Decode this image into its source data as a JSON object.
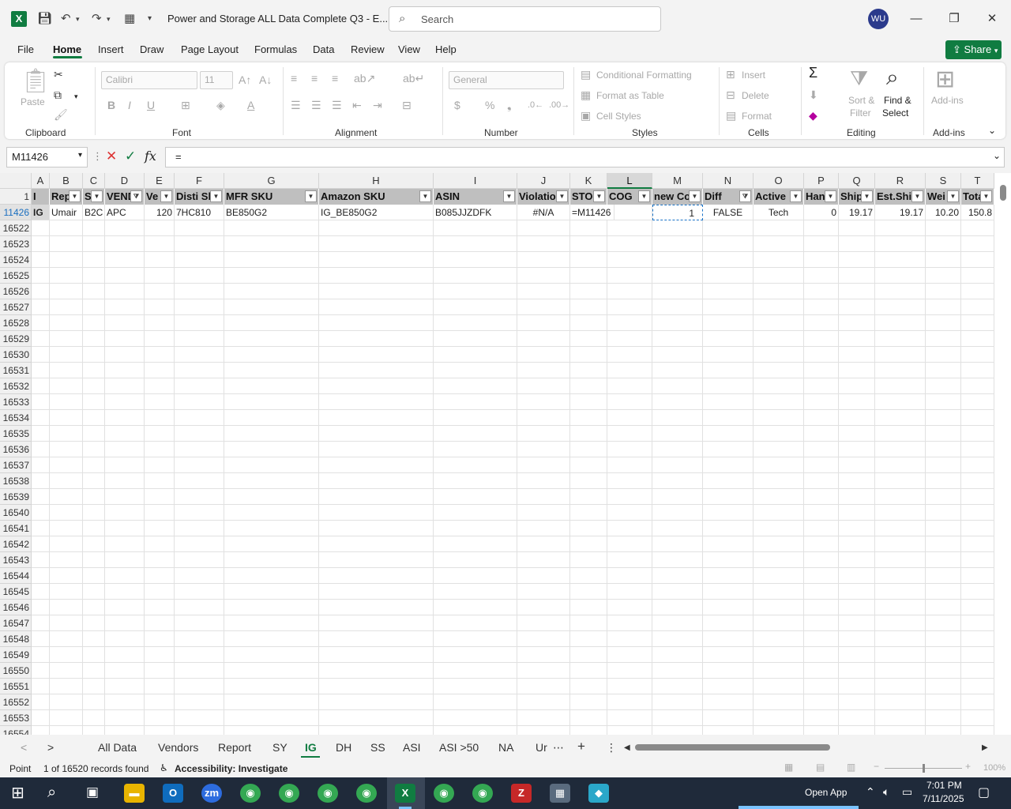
{
  "title_bar": {
    "doc_title": "Power and Storage ALL Data Complete Q3 - E...",
    "search_placeholder": "Search",
    "user_initials": "WU"
  },
  "menu": {
    "tabs": [
      "File",
      "Home",
      "Insert",
      "Draw",
      "Page Layout",
      "Formulas",
      "Data",
      "Review",
      "View",
      "Help"
    ],
    "active": "Home",
    "share": "Share"
  },
  "ribbon": {
    "clipboard": {
      "label": "Clipboard",
      "paste": "Paste"
    },
    "font": {
      "label": "Font",
      "name": "Calibri",
      "size": "11"
    },
    "alignment": {
      "label": "Alignment"
    },
    "number": {
      "label": "Number",
      "format": "General"
    },
    "styles": {
      "label": "Styles",
      "conditional": "Conditional Formatting",
      "format_table": "Format as Table",
      "cell_styles": "Cell Styles"
    },
    "cells": {
      "label": "Cells",
      "insert": "Insert",
      "delete": "Delete",
      "format": "Format"
    },
    "editing": {
      "label": "Editing",
      "sort": "Sort &",
      "filter": "Filter",
      "find": "Find &",
      "select": "Select"
    },
    "addins": {
      "label": "Add-ins",
      "btn": "Add-ins"
    }
  },
  "formula_bar": {
    "name_box": "M11426",
    "formula": "="
  },
  "columns": [
    "A",
    "B",
    "C",
    "D",
    "E",
    "F",
    "G",
    "H",
    "I",
    "J",
    "K",
    "L",
    "M",
    "N",
    "O",
    "P",
    "Q",
    "R",
    "S",
    "T"
  ],
  "header_row": {
    "row_num": "1",
    "cells": [
      "I",
      "Rep",
      "S",
      "VEND",
      "Ve",
      "Disti Sk",
      "MFR SKU",
      "Amazon SKU",
      "ASIN",
      "Violatio",
      "STOC",
      "COG",
      "new Co",
      "Diff",
      "Active",
      "Han",
      "Ship",
      "Est.Shi",
      "Wei",
      "Total"
    ]
  },
  "data_row": {
    "row_num": "11426",
    "cells": [
      "IG",
      "Umair",
      "B2C",
      "APC",
      "120",
      "7HC810",
      "BE850G2",
      "IG_BE850G2",
      "B085JJZDFK",
      "#N/A",
      "=M11426",
      "",
      "1",
      "FALSE",
      "Tech",
      "0",
      "19.17",
      "19.17",
      "10.20",
      "150.8"
    ]
  },
  "empty_rows": [
    "16522",
    "16523",
    "16524",
    "16525",
    "16526",
    "16527",
    "16528",
    "16529",
    "16530",
    "16531",
    "16532",
    "16533",
    "16534",
    "16535",
    "16536",
    "16537",
    "16538",
    "16539",
    "16540",
    "16541",
    "16542",
    "16543",
    "16544",
    "16545",
    "16546",
    "16547",
    "16548",
    "16549",
    "16550",
    "16551",
    "16552",
    "16553",
    "16554"
  ],
  "sheet_tabs": [
    "All Data",
    "Vendors",
    "Report",
    "SY",
    "IG",
    "DH",
    "SS",
    "ASI",
    "ASI >50",
    "NA",
    "Ur"
  ],
  "active_sheet": "IG",
  "status": {
    "mode": "Point",
    "records": "1 of 16520 records found",
    "accessibility": "Accessibility: Investigate",
    "zoom": "100%"
  },
  "taskbar": {
    "open_app": "Open App",
    "time": "7:01 PM",
    "date": "7/11/2025"
  }
}
